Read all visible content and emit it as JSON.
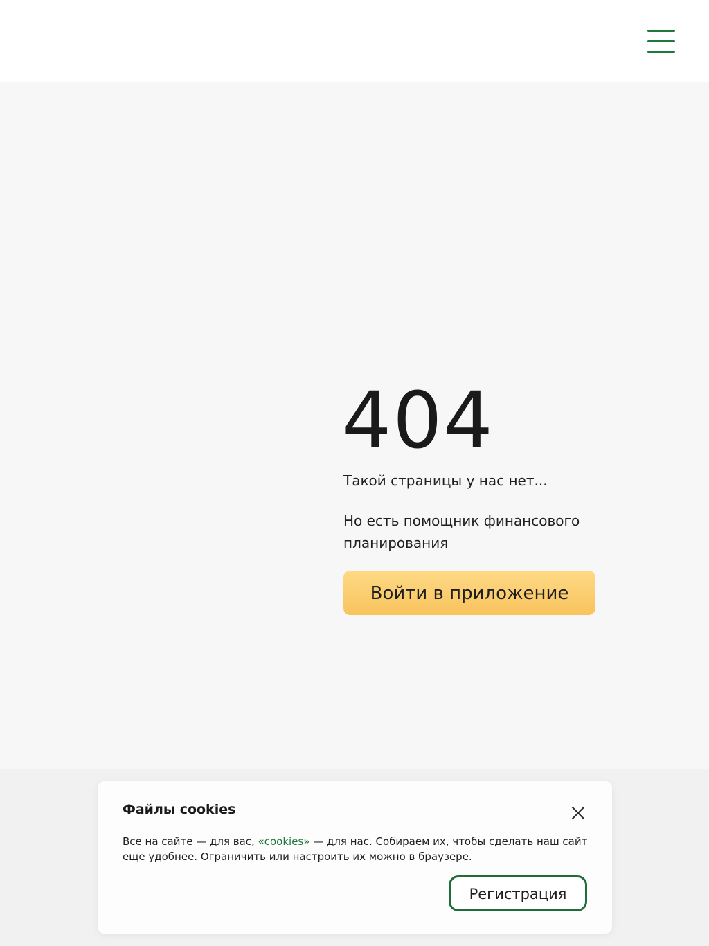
{
  "header": {
    "menu_icon": "hamburger-menu-icon"
  },
  "error": {
    "code": "404",
    "subtitle": "Такой страницы у нас нет...",
    "description": "Но есть помощник финансового планирования",
    "cta_label": "Войти в приложение"
  },
  "cookie_banner": {
    "title": "Файлы cookies",
    "close_icon": "close-icon",
    "text_before_link": "Все на сайте — для вас, ",
    "link_label": "«cookies»",
    "text_after_link": " — для нас. Собираем их, чтобы сделать наш сайт еще удобнее. Ограничить или настроить их можно в браузере.",
    "register_label": "Регистрация"
  },
  "colors": {
    "accent_green": "#1f7a3a",
    "cta_yellow": "#f8c35d",
    "page_background": "#f7f7f7"
  }
}
